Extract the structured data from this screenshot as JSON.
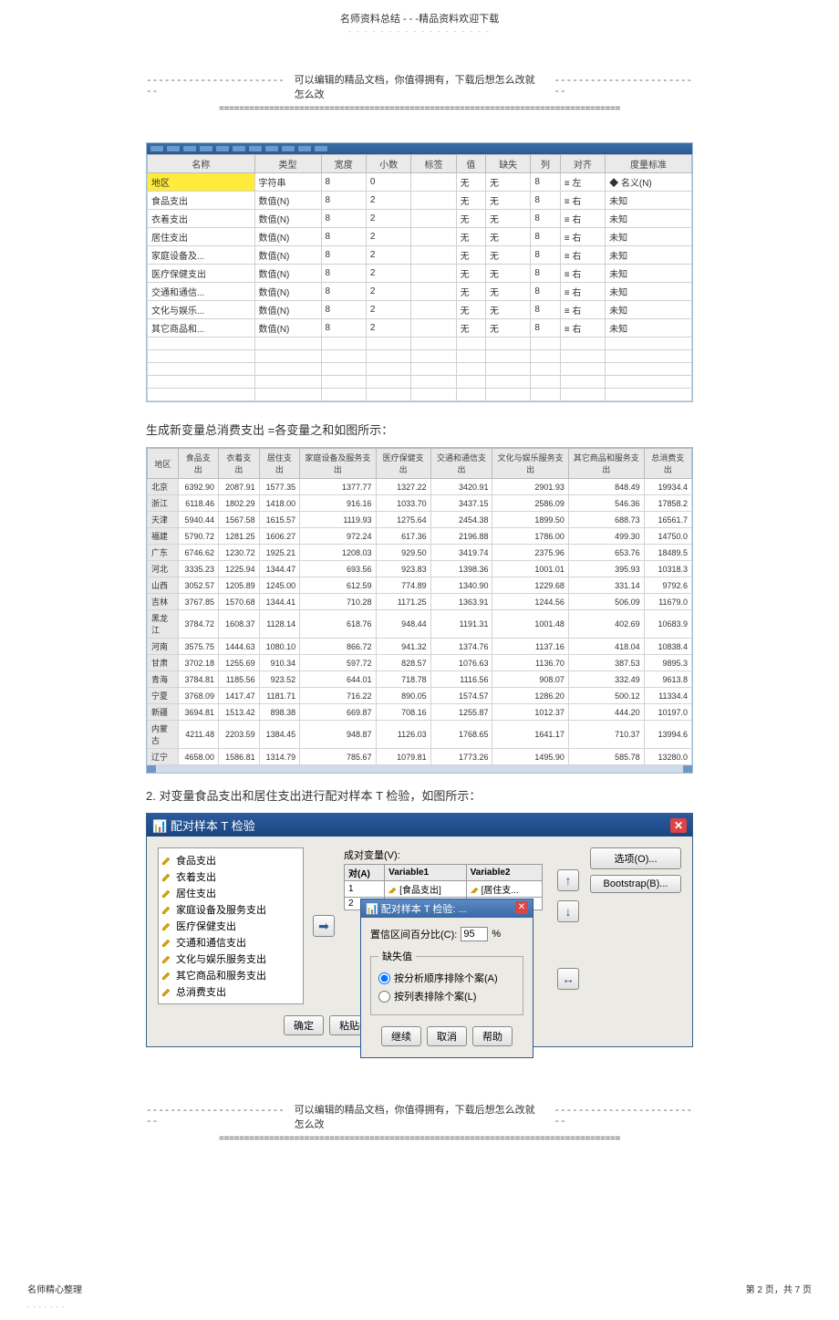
{
  "header": {
    "title": "名师资料总结 - - -精品资料欢迎下载",
    "dots": "- - - - - - - - - - - - - - - - - -"
  },
  "divider": {
    "dashes": "-------------------------",
    "text": "可以编辑的精品文档，你值得拥有，下载后想怎么改就怎么改",
    "equals": "================================================================================"
  },
  "var_table": {
    "headers": [
      "名称",
      "类型",
      "宽度",
      "小数",
      "标签",
      "值",
      "缺失",
      "列",
      "对齐",
      "度量标准"
    ],
    "rows": [
      {
        "name": "地区",
        "type": "字符串",
        "width": "8",
        "dec": "0",
        "label": "",
        "val": "无",
        "miss": "无",
        "col": "8",
        "align": "≡ 左",
        "measure": "名义(N)",
        "highlight": true,
        "measure_icon": "◆"
      },
      {
        "name": "食品支出",
        "type": "数值(N)",
        "width": "8",
        "dec": "2",
        "label": "",
        "val": "无",
        "miss": "无",
        "col": "8",
        "align": "≡ 右",
        "measure": "未知"
      },
      {
        "name": "衣着支出",
        "type": "数值(N)",
        "width": "8",
        "dec": "2",
        "label": "",
        "val": "无",
        "miss": "无",
        "col": "8",
        "align": "≡ 右",
        "measure": "未知"
      },
      {
        "name": "居住支出",
        "type": "数值(N)",
        "width": "8",
        "dec": "2",
        "label": "",
        "val": "无",
        "miss": "无",
        "col": "8",
        "align": "≡ 右",
        "measure": "未知"
      },
      {
        "name": "家庭设备及...",
        "type": "数值(N)",
        "width": "8",
        "dec": "2",
        "label": "",
        "val": "无",
        "miss": "无",
        "col": "8",
        "align": "≡ 右",
        "measure": "未知"
      },
      {
        "name": "医疗保健支出",
        "type": "数值(N)",
        "width": "8",
        "dec": "2",
        "label": "",
        "val": "无",
        "miss": "无",
        "col": "8",
        "align": "≡ 右",
        "measure": "未知"
      },
      {
        "name": "交通和通信...",
        "type": "数值(N)",
        "width": "8",
        "dec": "2",
        "label": "",
        "val": "无",
        "miss": "无",
        "col": "8",
        "align": "≡ 右",
        "measure": "未知"
      },
      {
        "name": "文化与娱乐...",
        "type": "数值(N)",
        "width": "8",
        "dec": "2",
        "label": "",
        "val": "无",
        "miss": "无",
        "col": "8",
        "align": "≡ 右",
        "measure": "未知"
      },
      {
        "name": "其它商品和...",
        "type": "数值(N)",
        "width": "8",
        "dec": "2",
        "label": "",
        "val": "无",
        "miss": "无",
        "col": "8",
        "align": "≡ 右",
        "measure": "未知"
      }
    ]
  },
  "section1_text": "生成新变量总消费支出 =各变量之和如图所示：",
  "data_table": {
    "headers": [
      "地区",
      "食品支出",
      "衣着支出",
      "居住支出",
      "家庭设备及服务支出",
      "医疗保健支出",
      "交通和通信支出",
      "文化与娱乐服务支出",
      "其它商品和服务支出",
      "总消费支出"
    ],
    "rows": [
      [
        "北京",
        "6392.90",
        "2087.91",
        "1577.35",
        "1377.77",
        "1327.22",
        "3420.91",
        "2901.93",
        "848.49",
        "19934.4"
      ],
      [
        "浙江",
        "6118.46",
        "1802.29",
        "1418.00",
        "916.16",
        "1033.70",
        "3437.15",
        "2586.09",
        "546.36",
        "17858.2"
      ],
      [
        "天津",
        "5940.44",
        "1567.58",
        "1615.57",
        "1119.93",
        "1275.64",
        "2454.38",
        "1899.50",
        "688.73",
        "16561.7"
      ],
      [
        "福建",
        "5790.72",
        "1281.25",
        "1606.27",
        "972.24",
        "617.36",
        "2196.88",
        "1786.00",
        "499.30",
        "14750.0"
      ],
      [
        "广东",
        "6746.62",
        "1230.72",
        "1925.21",
        "1208.03",
        "929.50",
        "3419.74",
        "2375.96",
        "653.76",
        "18489.5"
      ],
      [
        "河北",
        "3335.23",
        "1225.94",
        "1344.47",
        "693.56",
        "923.83",
        "1398.36",
        "1001.01",
        "395.93",
        "10318.3"
      ],
      [
        "山西",
        "3052.57",
        "1205.89",
        "1245.00",
        "612.59",
        "774.89",
        "1340.90",
        "1229.68",
        "331.14",
        "9792.6"
      ],
      [
        "吉林",
        "3767.85",
        "1570.68",
        "1344.41",
        "710.28",
        "1171.25",
        "1363.91",
        "1244.56",
        "506.09",
        "11679.0"
      ],
      [
        "黑龙江",
        "3784.72",
        "1608.37",
        "1128.14",
        "618.76",
        "948.44",
        "1191.31",
        "1001.48",
        "402.69",
        "10683.9"
      ],
      [
        "河南",
        "3575.75",
        "1444.63",
        "1080.10",
        "866.72",
        "941.32",
        "1374.76",
        "1137.16",
        "418.04",
        "10838.4"
      ],
      [
        "甘肃",
        "3702.18",
        "1255.69",
        "910.34",
        "597.72",
        "828.57",
        "1076.63",
        "1136.70",
        "387.53",
        "9895.3"
      ],
      [
        "青海",
        "3784.81",
        "1185.56",
        "923.52",
        "644.01",
        "718.78",
        "1116.56",
        "908.07",
        "332.49",
        "9613.8"
      ],
      [
        "宁夏",
        "3768.09",
        "1417.47",
        "1181.71",
        "716.22",
        "890.05",
        "1574.57",
        "1286.20",
        "500.12",
        "11334.4"
      ],
      [
        "新疆",
        "3694.81",
        "1513.42",
        "898.38",
        "669.87",
        "708.16",
        "1255.87",
        "1012.37",
        "444.20",
        "10197.0"
      ],
      [
        "内蒙古",
        "4211.48",
        "2203.59",
        "1384.45",
        "948.87",
        "1126.03",
        "1768.65",
        "1641.17",
        "710.37",
        "13994.6"
      ],
      [
        "辽宁",
        "4658.00",
        "1586.81",
        "1314.79",
        "785.67",
        "1079.81",
        "1773.26",
        "1495.90",
        "585.78",
        "13280.0"
      ]
    ]
  },
  "section2_text": "2.  对变量食品支出和居住支出进行配对样本    T 检验，如图所示：",
  "dialog": {
    "title": "配对样本 T 检验",
    "left_items": [
      "食品支出",
      "衣着支出",
      "居住支出",
      "家庭设备及服务支出",
      "医疗保健支出",
      "交通和通信支出",
      "文化与娱乐服务支出",
      "其它商品和服务支出",
      "总消费支出"
    ],
    "pair_label": "成对变量(V):",
    "pair_headers": [
      "对(A)",
      "Variable1",
      "Variable2"
    ],
    "pair_rows": [
      {
        "n": "1",
        "v1": "[食品支出]",
        "v2": "[居住支..."
      },
      {
        "n": "2",
        "v1": "",
        "v2": ""
      }
    ],
    "right_buttons": [
      "选项(O)...",
      "Bootstrap(B)..."
    ],
    "sub": {
      "title": "配对样本 T 检验: ...",
      "conf_label": "置信区间百分比(C):",
      "conf_value": "95",
      "pct": "%",
      "missing_legend": "缺失值",
      "radio1": "按分析顺序排除个案(A)",
      "radio2": "按列表排除个案(L)",
      "btn_continue": "继续",
      "btn_cancel": "取消",
      "btn_help": "帮助"
    },
    "footer_ok": "确定",
    "footer_paste": "粘贴("
  },
  "footer": {
    "left": "名师精心整理",
    "right": "第 2 页，共 7 页"
  }
}
